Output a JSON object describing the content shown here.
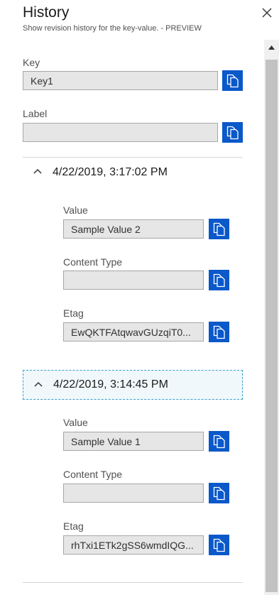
{
  "header": {
    "title": "History",
    "subtitle": "Show revision history for the key-value. - PREVIEW"
  },
  "key": {
    "label": "Key",
    "value": "Key1"
  },
  "label": {
    "label": "Label",
    "value": ""
  },
  "revisions": [
    {
      "date": "4/22/2019, 3:17:02 PM",
      "value_label": "Value",
      "value": "Sample Value 2",
      "content_type_label": "Content Type",
      "content_type": "",
      "etag_label": "Etag",
      "etag": "EwQKTFAtqwavGUzqiT0..."
    },
    {
      "date": "4/22/2019, 3:14:45 PM",
      "value_label": "Value",
      "value": "Sample Value 1",
      "content_type_label": "Content Type",
      "content_type": "",
      "etag_label": "Etag",
      "etag": "rhTxi1ETk2gSS6wmdIQG..."
    }
  ],
  "icons": {
    "copy": "copy-icon",
    "close": "close-icon",
    "chevron": "chevron-up-icon",
    "scroll_up": "scroll-up-arrow-icon"
  },
  "colors": {
    "copy_button": "#0a58ca",
    "input_bg": "#e6e6e6",
    "focus_border": "#3aa0c8"
  }
}
